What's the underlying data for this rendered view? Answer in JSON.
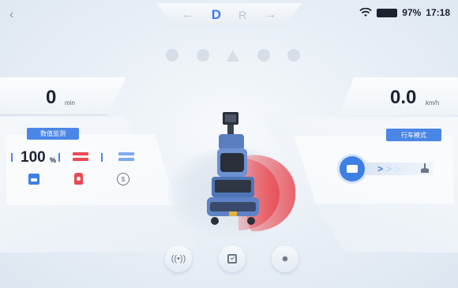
{
  "status_bar": {
    "battery_percent": "97%",
    "time": "17:18"
  },
  "gear": {
    "active": "D",
    "other": "R",
    "left_arrow": "←",
    "right_arrow": "→"
  },
  "nav": {
    "back_glyph": "‹"
  },
  "left_top": {
    "value": "0",
    "unit": "min"
  },
  "right_top": {
    "value": "0.0",
    "unit": "km/h"
  },
  "monitor": {
    "title": "数值监测",
    "level_value": "100",
    "level_unit": "%",
    "icons": [
      "water-tank-icon",
      "extinguisher-icon",
      "coin-icon"
    ]
  },
  "drive_mode": {
    "title": "行车模式",
    "arrows": [
      ">",
      ">",
      ">"
    ]
  },
  "bottom_buttons": {
    "signal_glyph": "((•))",
    "settings_glyph": "✹"
  },
  "colors": {
    "accent": "#3e7fe4",
    "danger": "#e94a52"
  }
}
